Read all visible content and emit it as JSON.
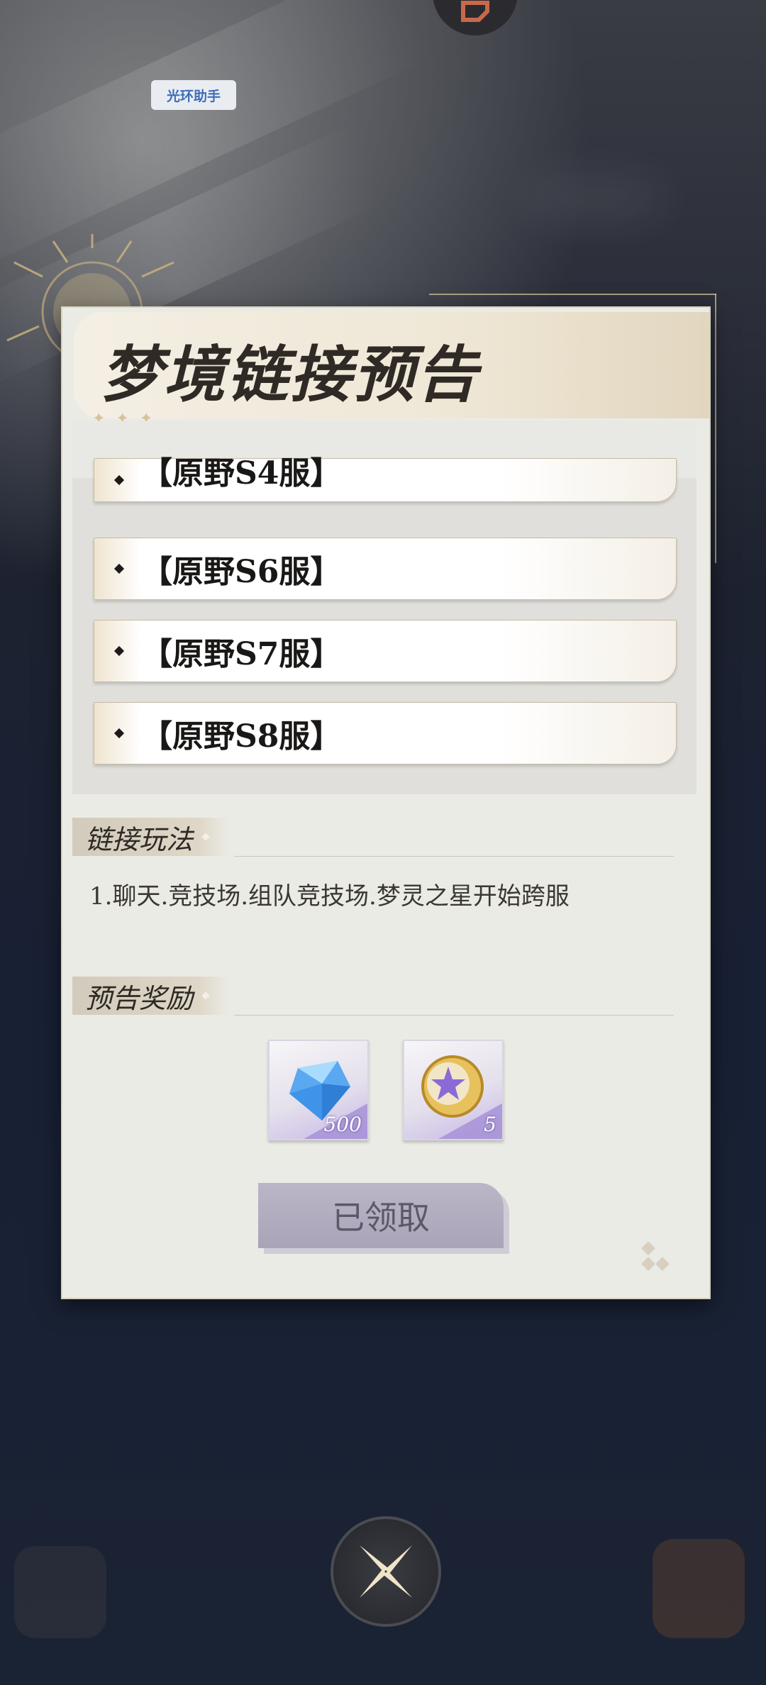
{
  "assistant_badge": "光环助手",
  "dialog": {
    "title": "梦境链接预告",
    "servers": [
      "【原野S4服】",
      "【原野S6服】",
      "【原野S7服】",
      "【原野S8服】"
    ],
    "gameplay_section": {
      "heading": "链接玩法",
      "text": "1.聊天.竞技场.组队竞技场.梦灵之星开始跨服"
    },
    "rewards_section": {
      "heading": "预告奖励",
      "items": [
        {
          "icon": "blue-crystal-icon",
          "count": "500"
        },
        {
          "icon": "star-coin-icon",
          "count": "5"
        }
      ]
    },
    "claim_button": "已领取"
  },
  "colors": {
    "panel_bg": "#ebebe6",
    "title_text": "#2f2a25",
    "button_bg": "#b2adbf",
    "accent_gold": "#d6c39a"
  }
}
